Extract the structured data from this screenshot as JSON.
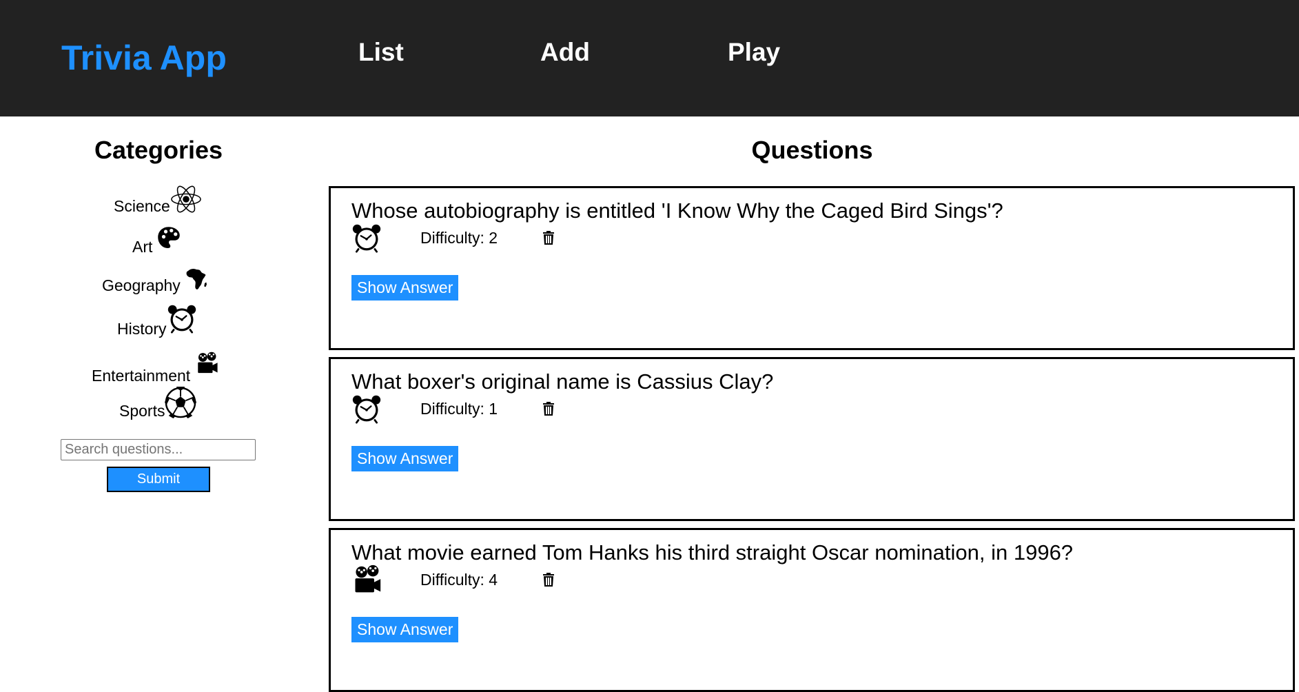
{
  "app": {
    "brand": "Trivia App",
    "nav": [
      "List",
      "Add",
      "Play"
    ]
  },
  "sidebar": {
    "heading": "Categories",
    "categories": [
      {
        "label": "Science",
        "icon": "atom-icon"
      },
      {
        "label": "Art",
        "icon": "palette-icon"
      },
      {
        "label": "Geography",
        "icon": "africa-map-icon"
      },
      {
        "label": "History",
        "icon": "alarm-clock-icon"
      },
      {
        "label": "Entertainment",
        "icon": "film-projector-icon"
      },
      {
        "label": "Sports",
        "icon": "soccer-ball-icon"
      }
    ],
    "search": {
      "placeholder": "Search questions...",
      "value": ""
    },
    "submit_label": "Submit"
  },
  "main": {
    "heading": "Questions",
    "questions": [
      {
        "text": "Whose autobiography is entitled 'I Know Why the Caged Bird Sings'?",
        "difficulty": "Difficulty: 2",
        "category_icon": "alarm-clock-icon",
        "action_label": "Show Answer"
      },
      {
        "text": "What boxer's original name is Cassius Clay?",
        "difficulty": "Difficulty: 1",
        "category_icon": "alarm-clock-icon",
        "action_label": "Show Answer"
      },
      {
        "text": "What movie earned Tom Hanks his third straight Oscar nomination, in 1996?",
        "difficulty": "Difficulty: 4",
        "category_icon": "film-projector-icon",
        "action_label": "Show Answer"
      }
    ]
  },
  "colors": {
    "navbar": "#222222",
    "accent": "#1e90ff",
    "nav_text": "#ffffff"
  }
}
